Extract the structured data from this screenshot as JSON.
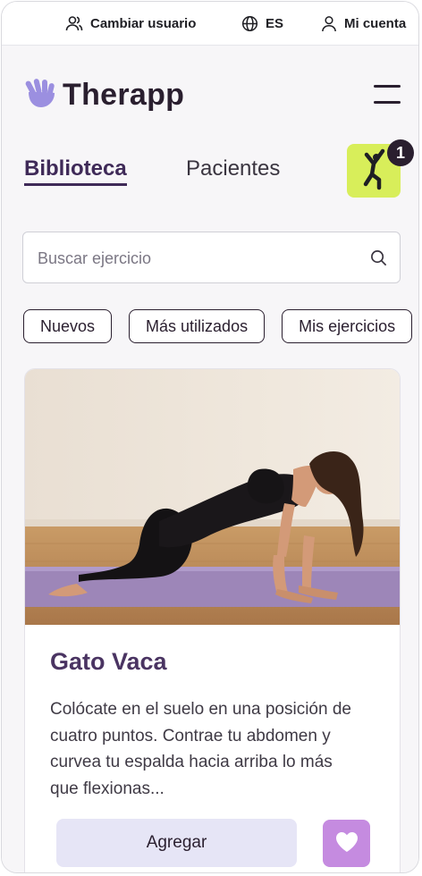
{
  "topbar": {
    "switch_user": {
      "label": "Cambiar usuario",
      "icon": "users-icon"
    },
    "language": {
      "label": "ES",
      "icon": "globe-icon"
    },
    "account": {
      "label": "Mi cuenta",
      "icon": "user-icon"
    }
  },
  "header": {
    "app_name": "Therapp",
    "logo_icon": "hand-logo-icon",
    "menu_icon": "hamburger-menu-icon"
  },
  "tabs": [
    {
      "label": "Biblioteca",
      "active": true
    },
    {
      "label": "Pacientes",
      "active": false
    }
  ],
  "selected_exercises": {
    "icon": "exercise-figure-icon",
    "count": "1",
    "accent": "#d8ee5a"
  },
  "search": {
    "placeholder": "Buscar ejercicio",
    "value": "",
    "icon": "search-icon"
  },
  "filters": [
    "Nuevos",
    "Más utilizados",
    "Mis ejercicios"
  ],
  "exercise_card": {
    "title": "Gato Vaca",
    "description": "Colócate en el suelo en una posición de cuatro puntos. Contrae tu abdomen y curvea tu espalda hacia arriba lo más que  flexionas...",
    "add_label": "Agregar",
    "favorite_icon": "heart-icon"
  },
  "colors": {
    "primary": "#3f2a58",
    "accent_lime": "#d8ee5a",
    "favorite": "#c58be0",
    "button_soft": "#e6e5f6"
  }
}
